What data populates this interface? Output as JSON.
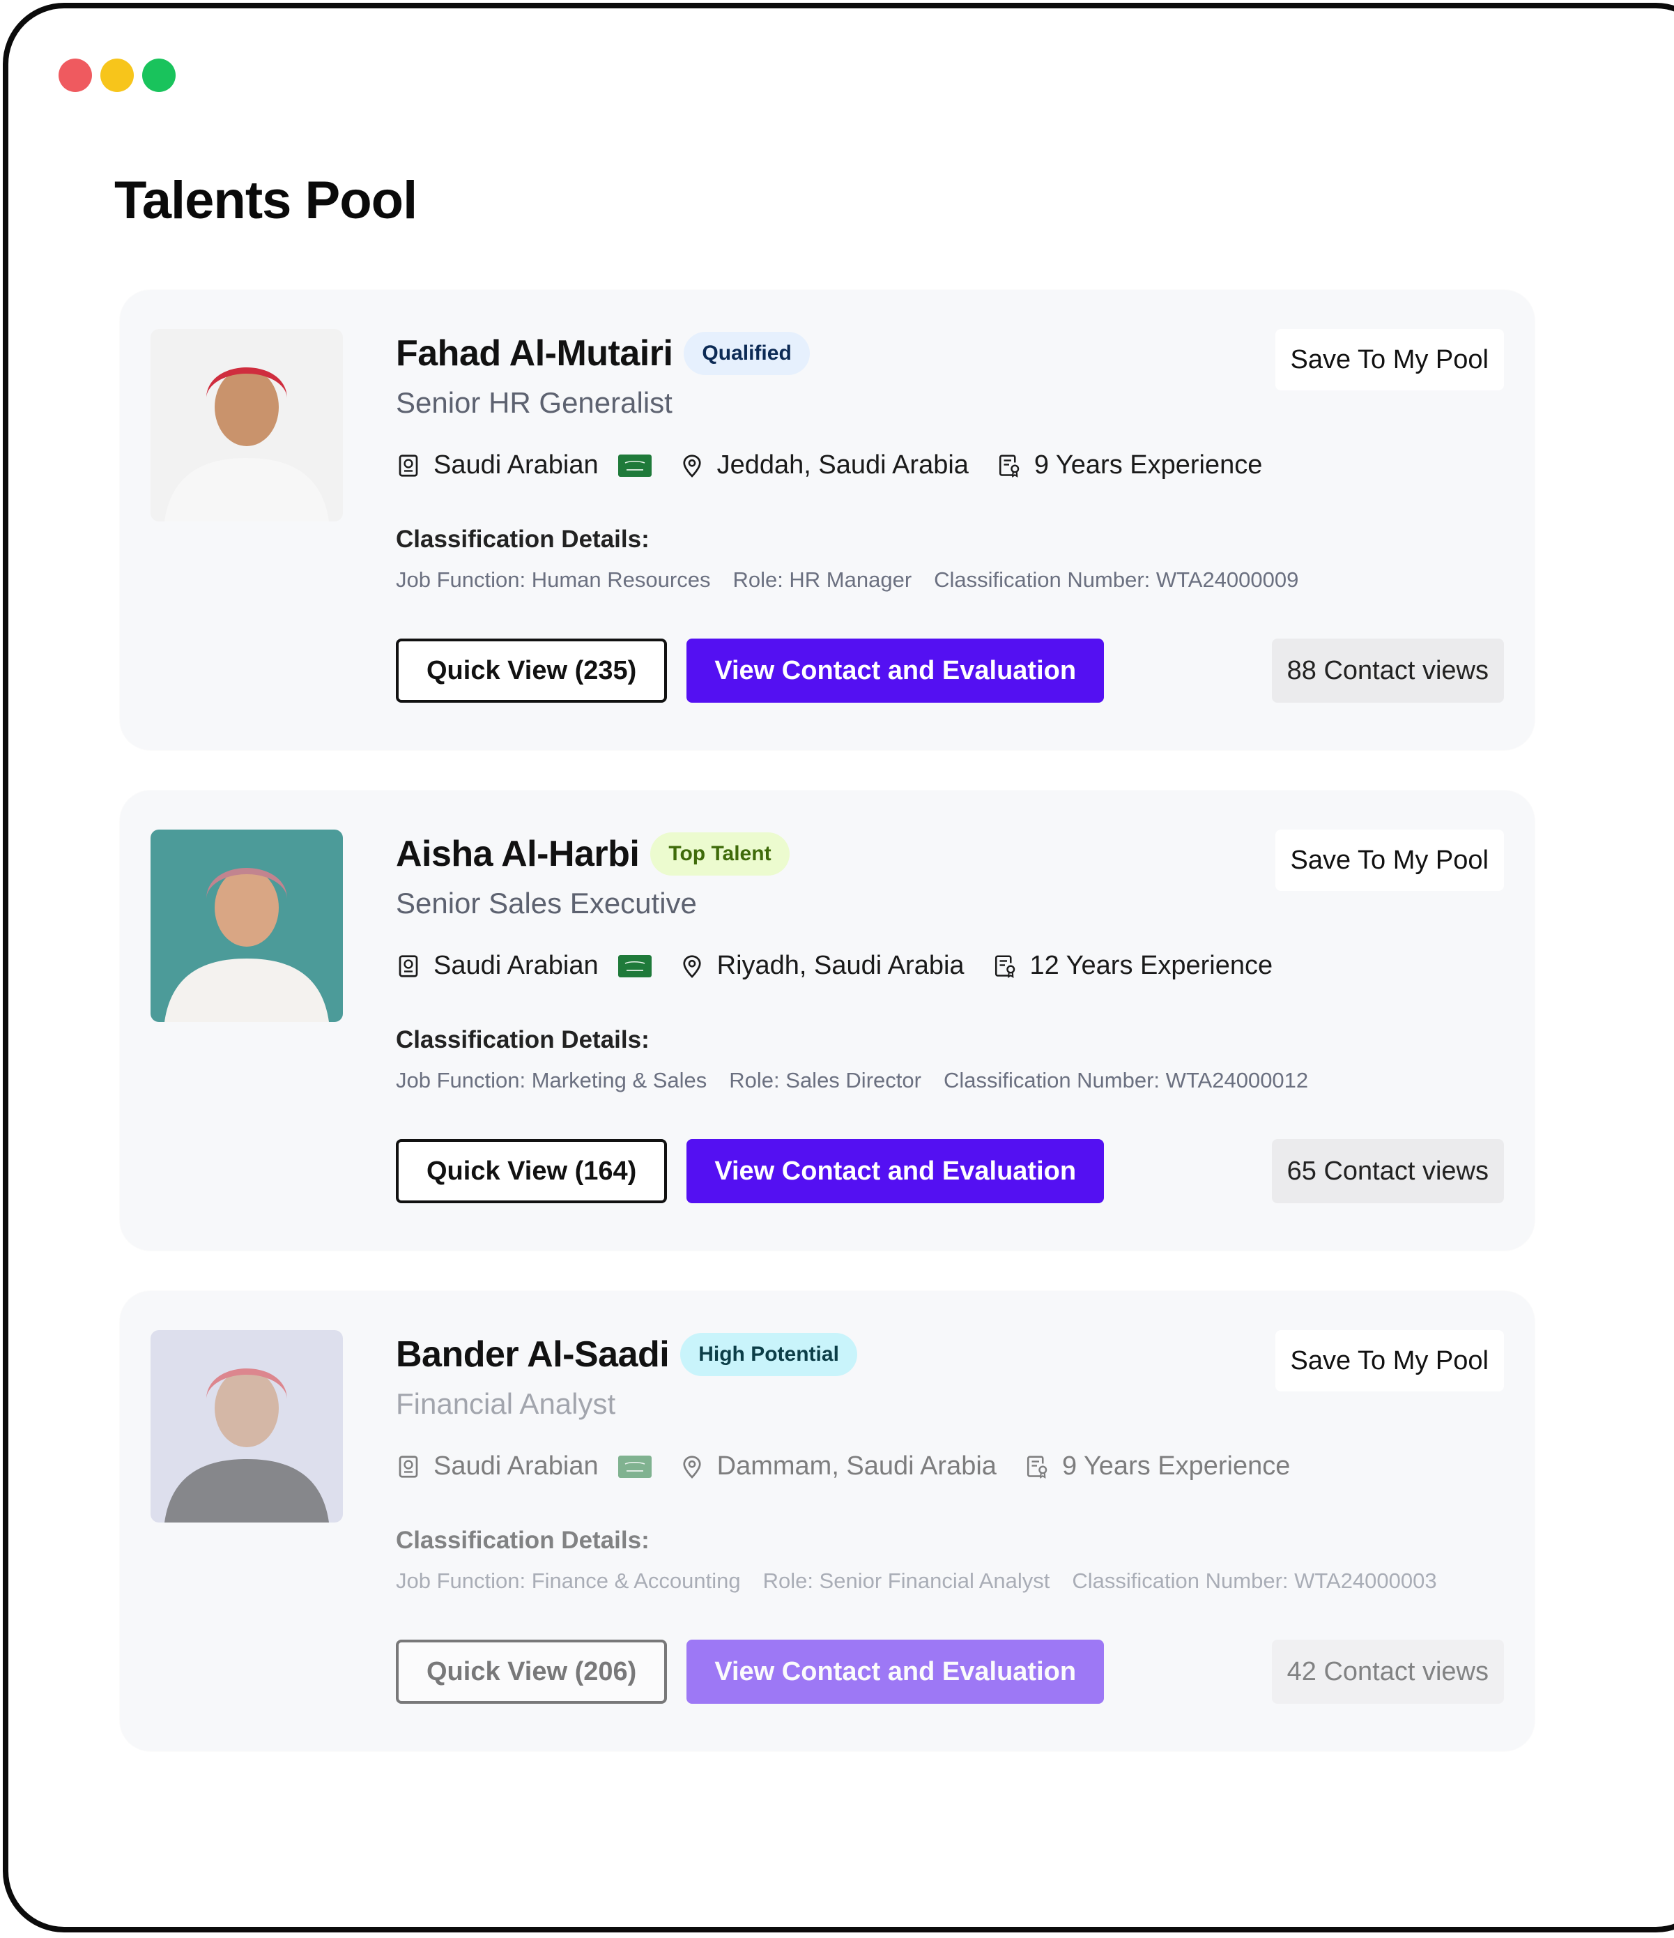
{
  "window": {
    "controls": [
      {
        "name": "close",
        "color": "#ef5a5f"
      },
      {
        "name": "minimize",
        "color": "#f7c51b"
      },
      {
        "name": "maximize",
        "color": "#19c35c"
      }
    ]
  },
  "page": {
    "title": "Talents Pool"
  },
  "colors": {
    "accent": "#5410f2",
    "card_bg": "#f7f8fa"
  },
  "save_label": "Save To My Pool",
  "classification_heading": "Classification Details:",
  "candidates": [
    {
      "name": "Fahad Al-Mutairi",
      "badge": "Qualified",
      "badge_bg": "#e6f0fd",
      "badge_fg": "#0c2a55",
      "title": "Senior HR Generalist",
      "nationality": "Saudi Arabian",
      "flag_icon": "saudi-flag",
      "location": "Jeddah, Saudi Arabia",
      "experience": "9 Years Experience",
      "job_function": "Job Function: Human Resources",
      "role": "Role: HR Manager",
      "classification_number": "Classification Number: WTA24000009",
      "quick_view": "Quick View (235)",
      "cta": "View Contact and Evaluation",
      "contact_views": "88 Contact views",
      "photo_bg": "#f2f2f2"
    },
    {
      "name": "Aisha Al-Harbi",
      "badge": "Top Talent",
      "badge_bg": "#ecfbcf",
      "badge_fg": "#3f6b0a",
      "title": "Senior Sales Executive",
      "nationality": "Saudi Arabian",
      "flag_icon": "saudi-flag",
      "location": "Riyadh, Saudi Arabia",
      "experience": "12 Years Experience",
      "job_function": "Job Function: Marketing & Sales",
      "role": "Role: Sales Director",
      "classification_number": "Classification Number: WTA24000012",
      "quick_view": "Quick View (164)",
      "cta": "View Contact and Evaluation",
      "contact_views": "65 Contact views",
      "photo_bg": "#4c9b99"
    },
    {
      "name": "Bander Al-Saadi",
      "badge": "High Potential",
      "badge_bg": "#c9f4fb",
      "badge_fg": "#0c3e48",
      "title": "Financial Analyst",
      "nationality": "Saudi Arabian",
      "flag_icon": "saudi-flag",
      "location": "Dammam, Saudi Arabia",
      "experience": "9 Years Experience",
      "job_function": "Job Function: Finance & Accounting",
      "role": "Role: Senior Financial Analyst",
      "classification_number": "Classification Number: WTA24000003",
      "quick_view": "Quick View (206)",
      "cta": "View Contact and Evaluation",
      "contact_views": "42 Contact views",
      "photo_bg": "#c8cbe4"
    }
  ]
}
